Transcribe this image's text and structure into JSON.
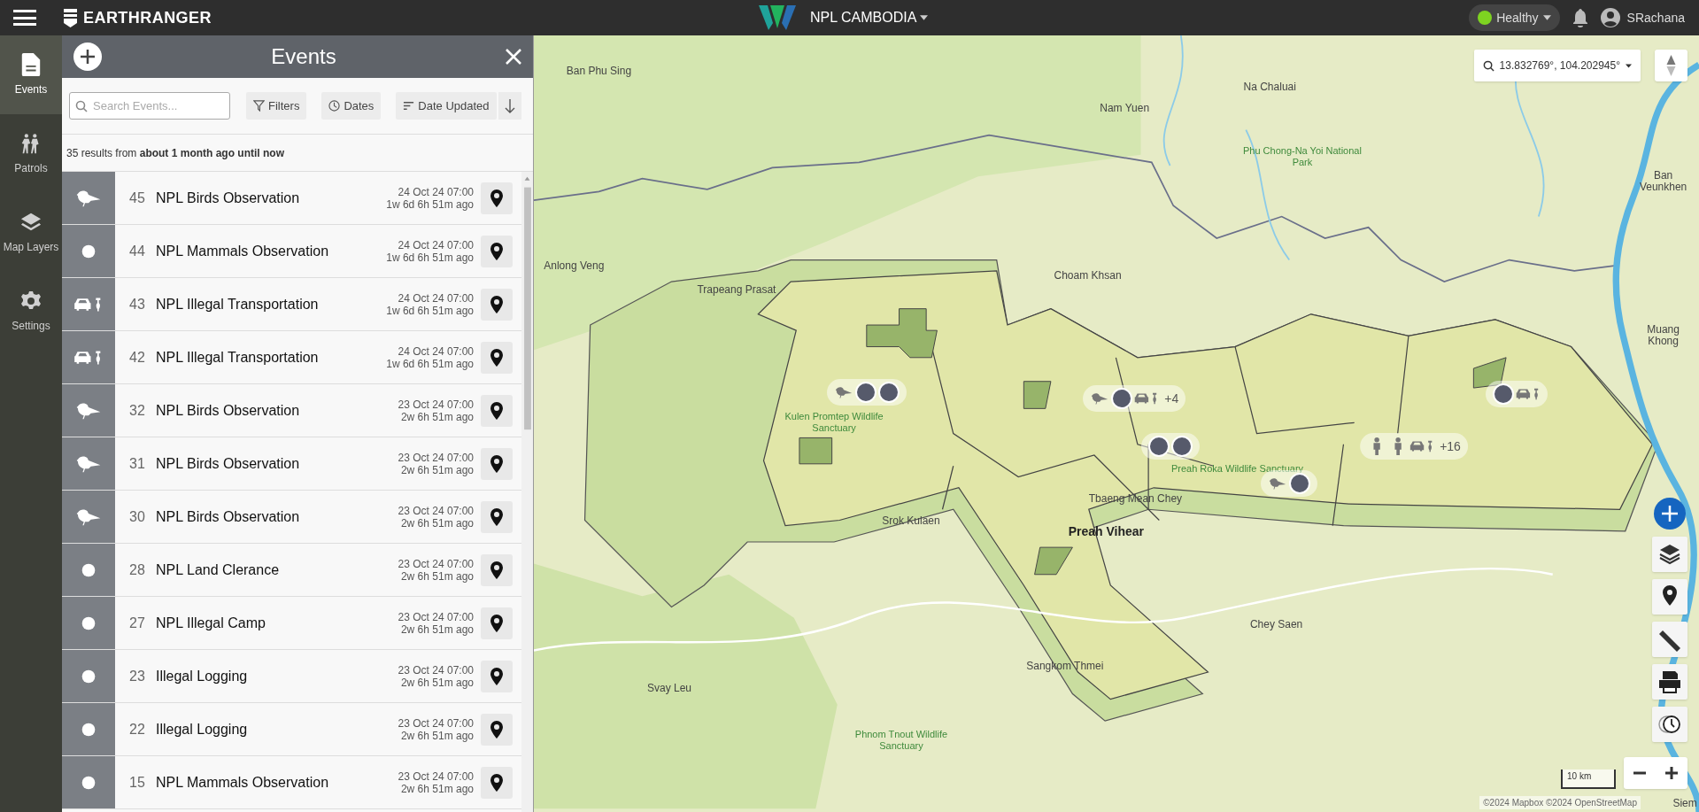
{
  "topbar": {
    "brand": "EARTHRANGER",
    "site": "NPL CAMBODIA",
    "status": {
      "label": "Healthy",
      "healthy": true
    },
    "user": "SRachana"
  },
  "nav": [
    {
      "label": "Events",
      "kind": "events",
      "selected": true
    },
    {
      "label": "Patrols",
      "kind": "patrols",
      "selected": false
    },
    {
      "label": "Map Layers",
      "kind": "layers",
      "selected": false
    },
    {
      "label": "Settings",
      "kind": "settings",
      "selected": false
    }
  ],
  "panel": {
    "title": "Events",
    "search": {
      "placeholder": "Search Events..."
    },
    "filters": "Filters",
    "dates": "Dates",
    "sort": "Date Updated",
    "summary": "35 results from **about 1 month ago until now**"
  },
  "events": [
    {
      "kind": "bird",
      "number": "45",
      "title": "NPL Birds Observation",
      "date": "24 Oct 24 07:00",
      "ago": "1w 6d 6h 51m ago"
    },
    {
      "kind": "dot",
      "number": "44",
      "title": "NPL Mammals Observation",
      "date": "24 Oct 24 07:00",
      "ago": "1w 6d 6h 51m ago"
    },
    {
      "kind": "vehicle",
      "number": "43",
      "title": "NPL Illegal Transportation",
      "date": "24 Oct 24 07:00",
      "ago": "1w 6d 6h 51m ago"
    },
    {
      "kind": "vehicle",
      "number": "42",
      "title": "NPL Illegal Transportation",
      "date": "24 Oct 24 07:00",
      "ago": "1w 6d 6h 51m ago"
    },
    {
      "kind": "bird",
      "number": "32",
      "title": "NPL Birds Observation",
      "date": "23 Oct 24 07:00",
      "ago": "2w 6h 51m ago"
    },
    {
      "kind": "bird",
      "number": "31",
      "title": "NPL Birds Observation",
      "date": "23 Oct 24 07:00",
      "ago": "2w 6h 51m ago"
    },
    {
      "kind": "bird",
      "number": "30",
      "title": "NPL Birds Observation",
      "date": "23 Oct 24 07:00",
      "ago": "2w 6h 51m ago"
    },
    {
      "kind": "dot",
      "number": "28",
      "title": "NPL Land Clerance",
      "date": "23 Oct 24 07:00",
      "ago": "2w 6h 51m ago"
    },
    {
      "kind": "dot",
      "number": "27",
      "title": "NPL Illegal Camp",
      "date": "23 Oct 24 07:00",
      "ago": "2w 6h 51m ago"
    },
    {
      "kind": "dot",
      "number": "23",
      "title": "Illegal Logging",
      "date": "23 Oct 24 07:00",
      "ago": "2w 6h 51m ago"
    },
    {
      "kind": "dot",
      "number": "22",
      "title": "Illegal Logging",
      "date": "23 Oct 24 07:00",
      "ago": "2w 6h 51m ago"
    },
    {
      "kind": "dot",
      "number": "15",
      "title": "NPL Mammals Observation",
      "date": "23 Oct 24 07:00",
      "ago": "2w 6h 51m ago"
    }
  ],
  "map": {
    "coordinates": "13.832769°, 104.202945°",
    "scale": "10 km",
    "attribution": "©2024 Mapbox ©2024 OpenStreetMap",
    "labels": [
      {
        "text": "Ban Phu Sing",
        "kind": "place"
      },
      {
        "text": "Na Chaluai",
        "kind": "place"
      },
      {
        "text": "Nam Yuen",
        "kind": "place"
      },
      {
        "text": "Phu Chong-Na Yoi National Park",
        "kind": "park"
      },
      {
        "text": "Ban Veunkhen",
        "kind": "place"
      },
      {
        "text": "Anlong Veng",
        "kind": "place"
      },
      {
        "text": "Choam Khsan",
        "kind": "place"
      },
      {
        "text": "Trapeang Prasat",
        "kind": "place"
      },
      {
        "text": "Muang Khong",
        "kind": "place"
      },
      {
        "text": "Kulen Promtep Wildlife Sanctuary",
        "kind": "park"
      },
      {
        "text": "Preah Roka Wildlife Sanctuary",
        "kind": "park"
      },
      {
        "text": "Tbaeng Mean Chey",
        "kind": "place"
      },
      {
        "text": "Srok Kulaen",
        "kind": "place"
      },
      {
        "text": "Preah Vihear",
        "kind": "town"
      },
      {
        "text": "Chey Saen",
        "kind": "place"
      },
      {
        "text": "Sangkom Thmei",
        "kind": "place"
      },
      {
        "text": "Svay Leu",
        "kind": "place"
      },
      {
        "text": "Phnom Tnout Wildlife Sanctuary",
        "kind": "park"
      },
      {
        "text": "Siem",
        "kind": "place"
      }
    ],
    "clusters": [
      {
        "markers": [
          {
            "kind": "bird"
          },
          {
            "kind": "dot"
          },
          {
            "kind": "dot"
          }
        ]
      },
      {
        "markers": [
          {
            "kind": "bird"
          },
          {
            "kind": "dot"
          },
          {
            "kind": "vehicle"
          }
        ],
        "more": "+4"
      },
      {
        "markers": [
          {
            "kind": "dot"
          },
          {
            "kind": "dot"
          }
        ]
      },
      {
        "markers": [
          {
            "kind": "bird"
          },
          {
            "kind": "dot"
          }
        ]
      },
      {
        "markers": [
          {
            "kind": "person"
          },
          {
            "kind": "person"
          },
          {
            "kind": "vehicle"
          }
        ],
        "more": "+16"
      },
      {
        "markers": [
          {
            "kind": "dot"
          },
          {
            "kind": "vehicle"
          }
        ]
      }
    ]
  }
}
